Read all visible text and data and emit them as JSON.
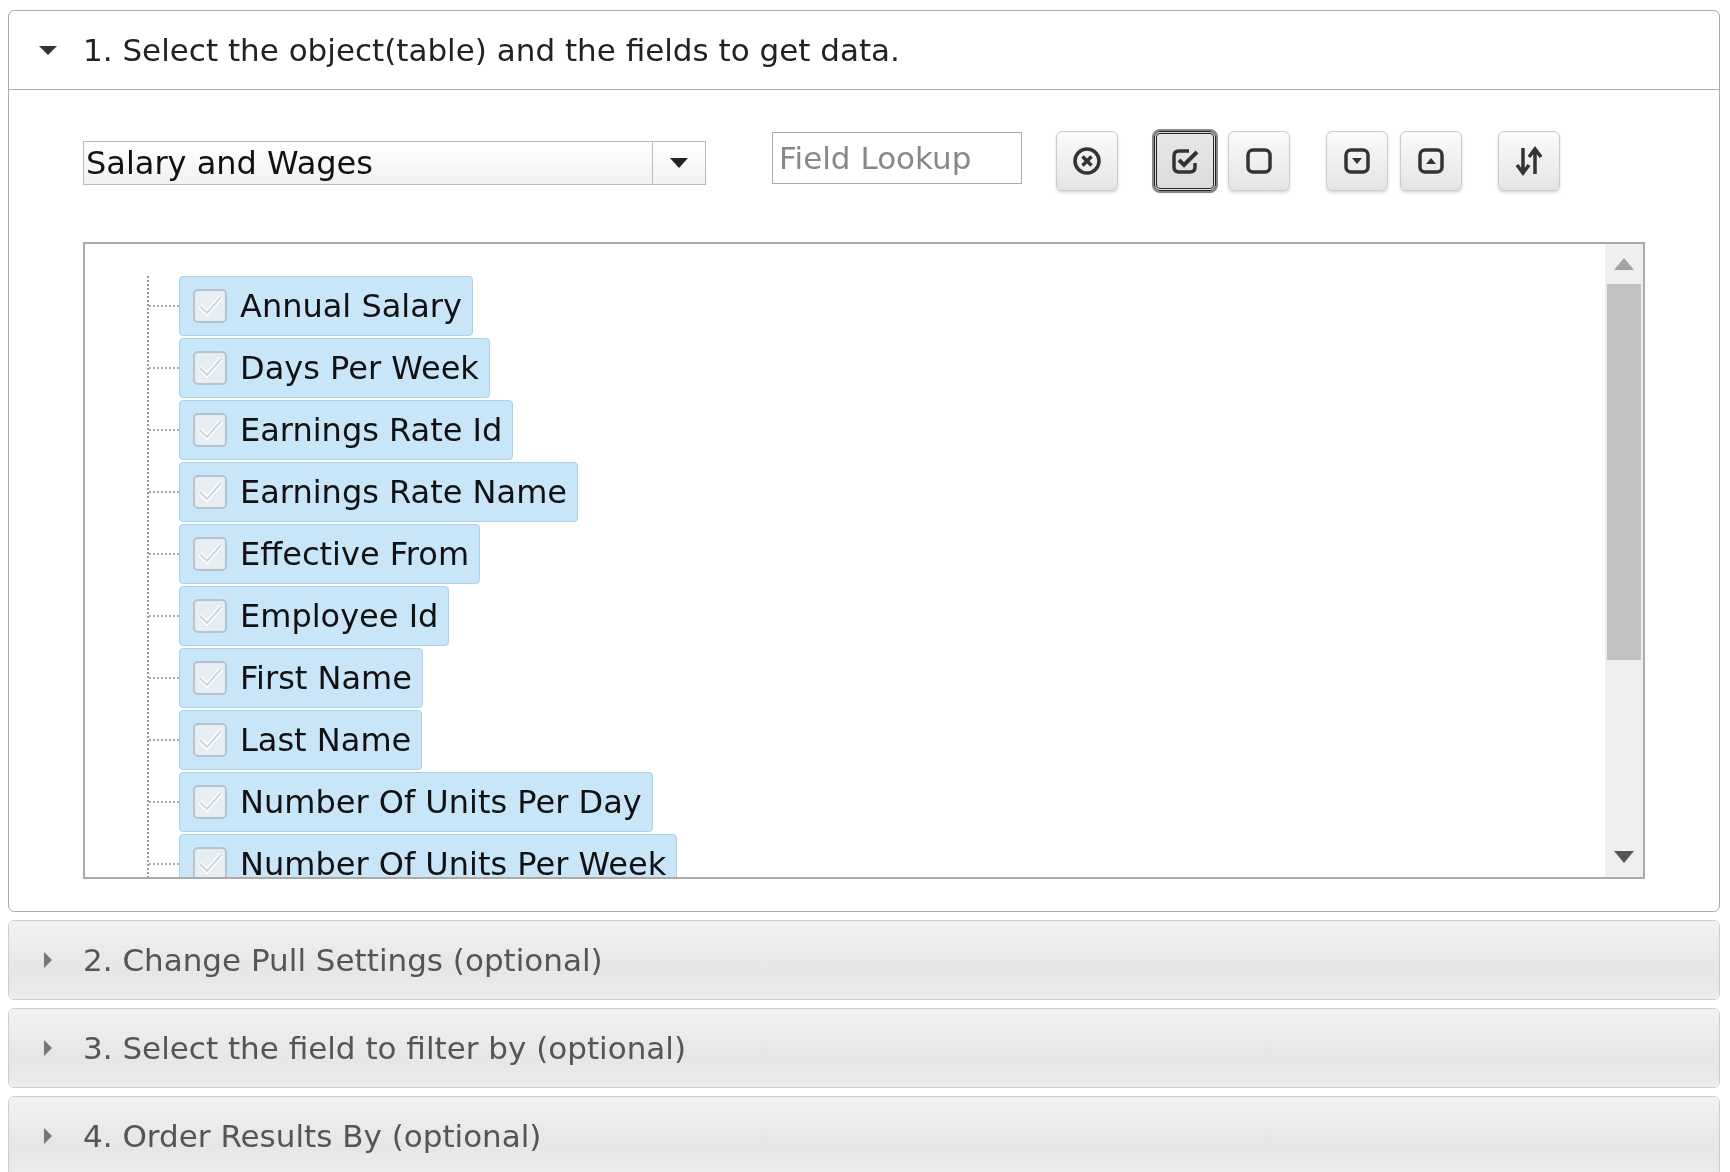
{
  "sections": [
    {
      "title": "1. Select the object(table) and the fields to get data.",
      "expanded": true
    },
    {
      "title": "2. Change Pull Settings (optional)",
      "expanded": false
    },
    {
      "title": "3. Select the field to filter by (optional)",
      "expanded": false
    },
    {
      "title": "4. Order Results By (optional)",
      "expanded": false
    }
  ],
  "object_select": {
    "value": "Salary and Wages"
  },
  "field_lookup": {
    "placeholder": "Field Lookup"
  },
  "toolbar_groups": [
    {
      "buttons": [
        {
          "kind": "clear",
          "pressed": false
        }
      ]
    },
    {
      "buttons": [
        {
          "kind": "check-all",
          "pressed": true
        },
        {
          "kind": "uncheck-all",
          "pressed": false
        }
      ]
    },
    {
      "buttons": [
        {
          "kind": "expand",
          "pressed": false
        },
        {
          "kind": "collapse",
          "pressed": false
        }
      ]
    },
    {
      "buttons": [
        {
          "kind": "sort",
          "pressed": false
        }
      ]
    }
  ],
  "fields": [
    {
      "label": "Annual Salary",
      "checked": true,
      "selected": true
    },
    {
      "label": "Days Per Week",
      "checked": true,
      "selected": true
    },
    {
      "label": "Earnings Rate Id",
      "checked": true,
      "selected": true
    },
    {
      "label": "Earnings Rate Name",
      "checked": true,
      "selected": true
    },
    {
      "label": "Effective From",
      "checked": true,
      "selected": true
    },
    {
      "label": "Employee Id",
      "checked": true,
      "selected": true
    },
    {
      "label": "First Name",
      "checked": true,
      "selected": true
    },
    {
      "label": "Last Name",
      "checked": true,
      "selected": true
    },
    {
      "label": "Number Of Units Per Day",
      "checked": true,
      "selected": true
    },
    {
      "label": "Number Of Units Per Week",
      "checked": true,
      "selected": true
    }
  ]
}
